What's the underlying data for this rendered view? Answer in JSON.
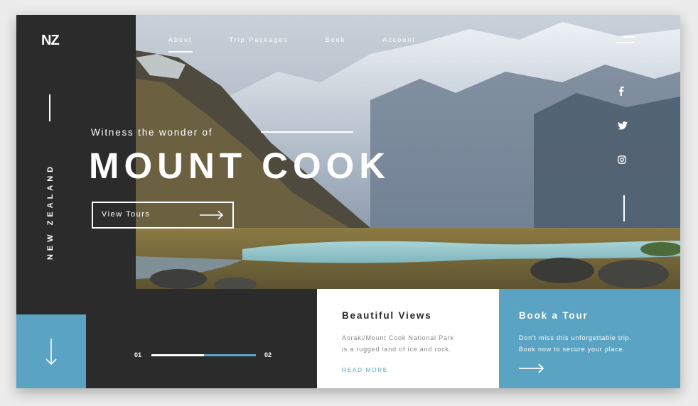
{
  "brand": {
    "logo": "NZ",
    "country": "NEW ZEALAND"
  },
  "nav": {
    "items": [
      "About",
      "Trip Packages",
      "Book",
      "Account"
    ],
    "active": "About"
  },
  "social": [
    "facebook-icon",
    "twitter-icon",
    "instagram-icon"
  ],
  "hero": {
    "tagline": "Witness the wonder of",
    "headline": "MOUNT COOK",
    "cta_label": "View Tours"
  },
  "pager": {
    "start": "01",
    "end": "02",
    "progress": 0.5
  },
  "card_views": {
    "title": "Beautiful Views",
    "line1": "Aoraki/Mount Cook National Park",
    "line2": "is a rugged land of ice and rock.",
    "link": "READ MORE"
  },
  "card_tour": {
    "title": "Book a Tour",
    "line1": "Don't miss this unforgettable trip.",
    "line2": "Book now to secure your place."
  },
  "colors": {
    "accent": "#5ba3c2",
    "dark": "#2b2b2b",
    "white": "#ffffff"
  }
}
